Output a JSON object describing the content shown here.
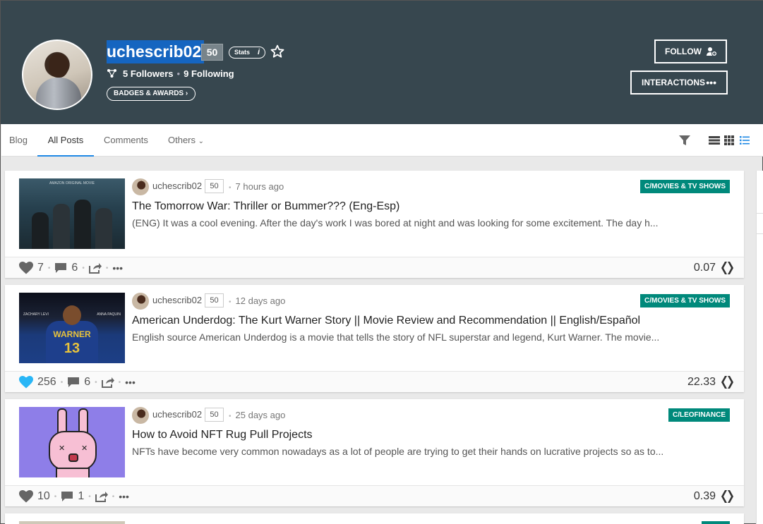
{
  "profile": {
    "username": "uchescrib02",
    "reputation": "50",
    "stats_label": "Stats",
    "stats_info": "i",
    "followers_count": "5",
    "followers_label": "Followers",
    "following_count": "9",
    "following_label": "Following",
    "badges_label": "BADGES & AWARDS",
    "follow_label": "FOLLOW",
    "interactions_label": "INTERACTIONS",
    "header_color": "#37474f"
  },
  "tabs": [
    {
      "label": "Blog"
    },
    {
      "label": "All Posts"
    },
    {
      "label": "Comments"
    },
    {
      "label": "Others"
    }
  ],
  "posts": [
    {
      "author": "uchescrib02",
      "author_rep": "50",
      "time": "7 hours ago",
      "community": "C/MOVIES & TV SHOWS",
      "title": "The Tomorrow War: Thriller or Bummer??? (Eng-Esp)",
      "excerpt": "(ENG) It was a cool evening. After the day's work I was bored at night and was looking for some excitement. The day h...",
      "likes": "7",
      "liked": false,
      "comments": "6",
      "payout": "0.07",
      "thumb_caption": "AMAZON ORIGINAL MOVIE"
    },
    {
      "author": "uchescrib02",
      "author_rep": "50",
      "time": "12 days ago",
      "community": "C/MOVIES & TV SHOWS",
      "title": "American Underdog: The Kurt Warner Story || Movie Review and Recommendation || English/Español",
      "excerpt": "English source American Underdog is a movie that tells the story of NFL superstar and legend, Kurt Warner. The movie...",
      "likes": "256",
      "liked": true,
      "comments": "6",
      "payout": "22.33",
      "thumb_left_caption": "ZACHARY LEVI",
      "thumb_right_caption": "ANNA PAQUIN",
      "thumb_jersey_name": "WARNER",
      "thumb_jersey_number": "13"
    },
    {
      "author": "uchescrib02",
      "author_rep": "50",
      "time": "25 days ago",
      "community": "C/LEOFINANCE",
      "title": "How to Avoid NFT Rug Pull Projects",
      "excerpt": "NFTs have become very common nowadays as a lot of people are trying to get their hands on lucrative projects so as to...",
      "likes": "10",
      "liked": false,
      "comments": "1",
      "payout": "0.39"
    }
  ],
  "colors": {
    "accent": "#1e88e5",
    "community_tag": "#00897b",
    "like_active": "#29b6f6",
    "like_inactive": "#666666"
  }
}
